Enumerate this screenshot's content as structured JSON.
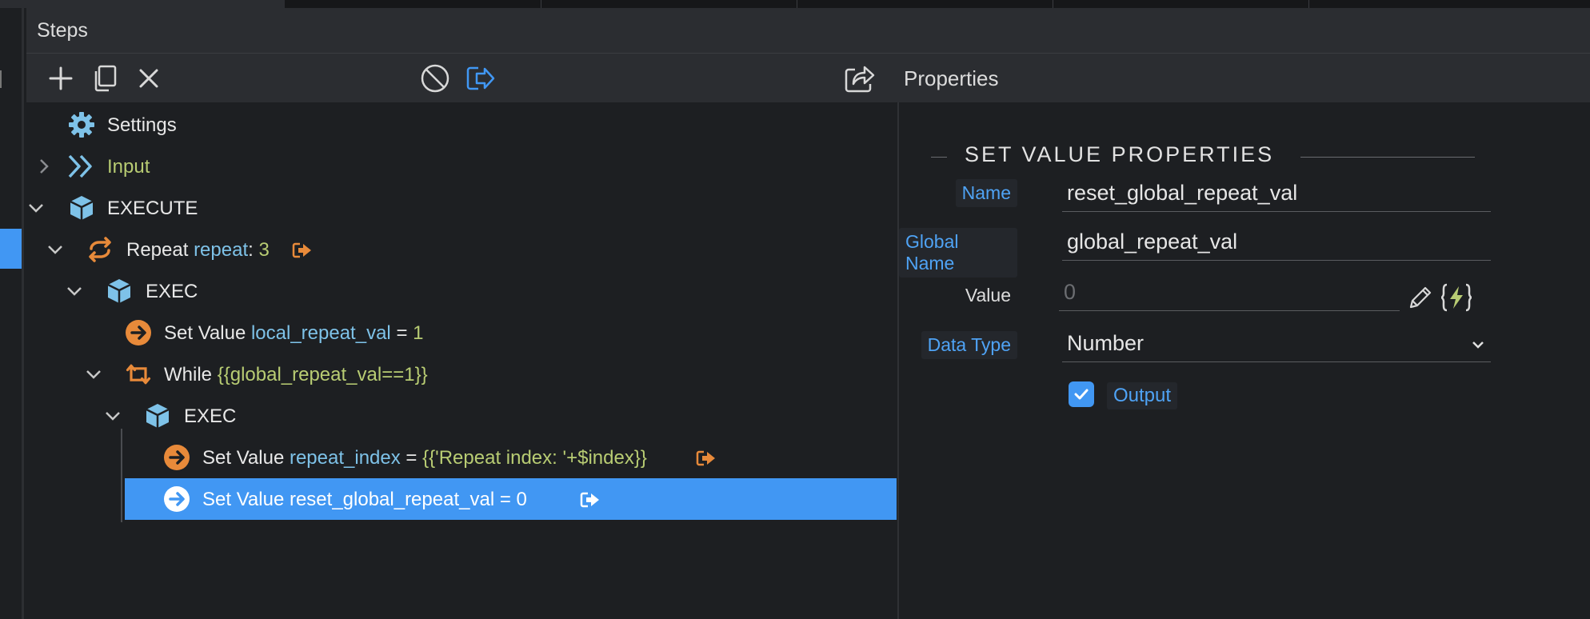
{
  "panel": {
    "title": "Steps"
  },
  "toolbar": {
    "add": "add-step",
    "copy": "copy-step",
    "remove": "remove-step",
    "disable": "disable-step",
    "output": "output-step",
    "export": "export",
    "properties_label": "Properties"
  },
  "tree": {
    "settings": {
      "label": "Settings"
    },
    "input": {
      "label": "Input"
    },
    "execute": {
      "label": "EXECUTE"
    },
    "repeat": {
      "label": "Repeat",
      "name": "repeat",
      "sep": ":",
      "value": "3"
    },
    "exec1": {
      "label": "EXEC"
    },
    "setvalue1": {
      "label": "Set Value",
      "name": "local_repeat_val",
      "op": "=",
      "value": "1"
    },
    "while": {
      "label": "While",
      "cond": "{{global_repeat_val==1}}"
    },
    "exec2": {
      "label": "EXEC"
    },
    "setvalue2": {
      "label": "Set Value",
      "name": "repeat_index",
      "op": "=",
      "value": "{{'Repeat index: '+$index}}"
    },
    "setvalue3": {
      "label": "Set Value reset_global_repeat_val = 0"
    }
  },
  "properties": {
    "section_title": "SET VALUE PROPERTIES",
    "name_label": "Name",
    "name_value": "reset_global_repeat_val",
    "global_name_label": "Global Name",
    "global_name_value": "global_repeat_val",
    "value_label": "Value",
    "value_placeholder": "0",
    "data_type_label": "Data Type",
    "data_type_value": "Number",
    "output_label": "Output",
    "output_checked": true
  },
  "colors": {
    "accent": "#4197f3",
    "green": "#b8cc73",
    "blue": "#7ec2e8",
    "orange": "#e88a3a"
  }
}
